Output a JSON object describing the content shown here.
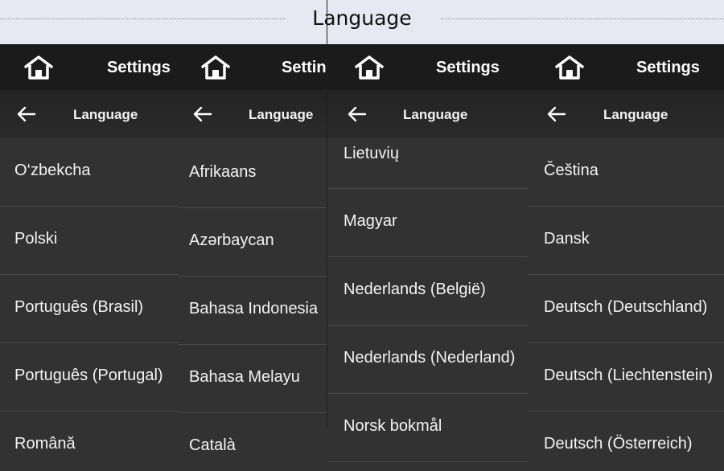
{
  "banner": {
    "title": "Language"
  },
  "panels": [
    {
      "settings_title": "Settings",
      "sub_title": "Language",
      "items": [
        "O‘zbekcha",
        "Polski",
        "Português (Brasil)",
        "Português (Portugal)",
        "Română"
      ]
    },
    {
      "settings_title": "Settin",
      "sub_title": "Language",
      "items": [
        "Afrikaans",
        "Azərbaycan",
        "Bahasa Indonesia",
        "Bahasa Melayu",
        "Català"
      ]
    },
    {
      "settings_title": "Settings",
      "sub_title": "Language",
      "items": [
        "Lietuvių",
        "Magyar",
        "Nederlands (België)",
        "Nederlands (Nederland)",
        "Norsk bokmål"
      ]
    },
    {
      "settings_title": "Settings",
      "sub_title": "Language",
      "items": [
        "Čeština",
        "Dansk",
        "Deutsch (Deutschland)",
        "Deutsch (Liechtenstein)",
        "Deutsch (Österreich)"
      ]
    }
  ],
  "icons": {
    "home": "home-icon",
    "back": "back-arrow-icon"
  },
  "colors": {
    "topbar": "#1b1b1c",
    "list_bg": "#323232",
    "banner_bg": "#e7e8f2"
  }
}
